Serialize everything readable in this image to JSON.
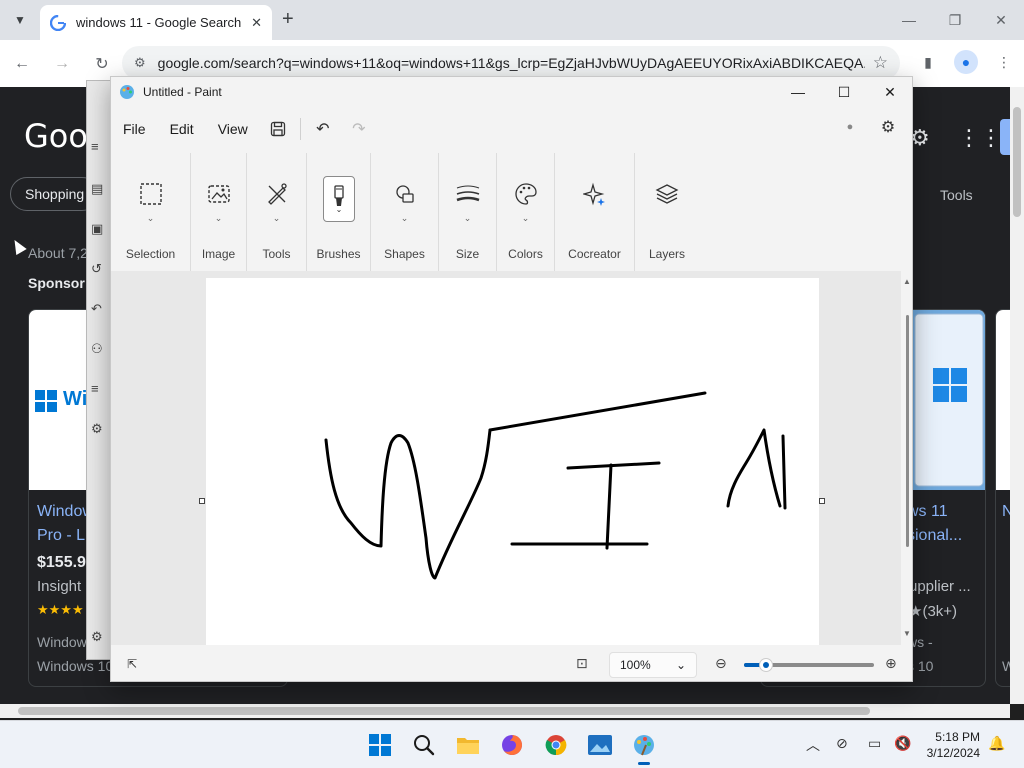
{
  "browser": {
    "tab_title": "windows 11 - Google Search",
    "url": "google.com/search?q=windows+11&oq=windows+11&gs_lcrp=EgZjaHJvbWUyDAgAEEUYORixAxiABDIKCAEQA..."
  },
  "google": {
    "logo": "Goog",
    "chip_shopping": "Shopping",
    "tools": "Tools",
    "about": "About 7,2",
    "sponsored": "Sponsor",
    "card1": {
      "logo_text": "Wi",
      "title1": "Window",
      "title2": "Pro - L",
      "price": "$155.9",
      "store": "Insight",
      "stars": "★★★★",
      "line1": "Window",
      "line2": "Windows 10"
    },
    "card2": {
      "title1": "ws 11",
      "title2": "sional...",
      "store": "upplier ...",
      "rating": "★(3k+)",
      "line1": "ws -",
      "line2": "s 10"
    },
    "card3": {
      "t1": "N",
      "t2": "W"
    }
  },
  "paint": {
    "title": "Untitled - Paint",
    "menu": {
      "file": "File",
      "edit": "Edit",
      "view": "View"
    },
    "ribbon": [
      {
        "label": "Selection"
      },
      {
        "label": "Image"
      },
      {
        "label": "Tools"
      },
      {
        "label": "Brushes"
      },
      {
        "label": "Shapes"
      },
      {
        "label": "Size"
      },
      {
        "label": "Colors"
      },
      {
        "label": "Cocreator"
      },
      {
        "label": "Layers"
      }
    ],
    "zoom": "100%",
    "zoom_level_fraction": 0.17
  },
  "taskbar": {
    "time": "5:18 PM",
    "date": "3/12/2024"
  },
  "colors": {
    "accent": "#005fb8",
    "paint_bg": "#f3f3f3",
    "google_bg": "#202124"
  }
}
